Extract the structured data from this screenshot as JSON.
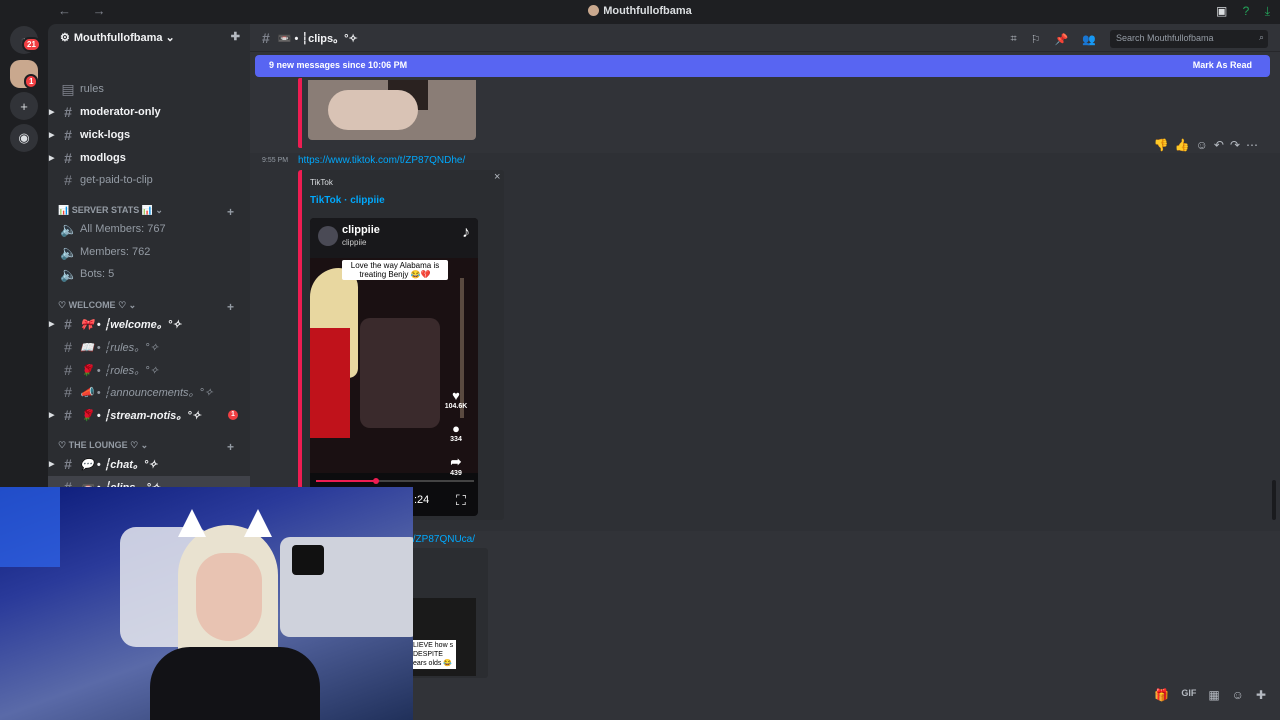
{
  "window": {
    "title": "Mouthfullofbama",
    "back_glyph": "←",
    "forward_glyph": "→",
    "inbox_glyph": "▣",
    "help_glyph": "?",
    "download_glyph": "⤓"
  },
  "guilds": {
    "dm_badge": "21",
    "server_badge": "1",
    "add_glyph": "+",
    "discover_glyph": "◉",
    "dm_glyph": "◔"
  },
  "server": {
    "name": "Mouthfullofbama ⌄",
    "invite_glyph": "✚"
  },
  "channels": [
    {
      "name": "rules",
      "style": "muted",
      "icon": "▤"
    },
    {
      "name": "moderator-only",
      "style": "bold",
      "icon": "#"
    },
    {
      "name": "wick-logs",
      "style": "bold",
      "icon": "#"
    },
    {
      "name": "modlogs",
      "style": "bold",
      "icon": "#"
    },
    {
      "name": "get-paid-to-clip",
      "style": "muted",
      "icon": "#"
    }
  ],
  "categories": {
    "server_stats": "📊 SERVER STATS 📊 ⌄",
    "welcome": "♡ WELCOME ♡ ⌄",
    "lounge": "♡ THE LOUNGE ♡ ⌄",
    "plus": "+"
  },
  "stats": [
    {
      "name": "All Members: 767"
    },
    {
      "name": "Members: 762"
    },
    {
      "name": "Bots: 5"
    }
  ],
  "welcome_channels": [
    {
      "name": "🎀 • ┆welcome。°✧",
      "style": "bold"
    },
    {
      "name": "📖 • ┆rules。°✧",
      "style": "muted"
    },
    {
      "name": "🌹 • ┆roles。°✧",
      "style": "muted"
    },
    {
      "name": "📣 • ┆announcements。°✧",
      "style": "muted"
    },
    {
      "name": "🌹 • ┆stream-notis。°✧",
      "style": "bold",
      "badge": "1"
    }
  ],
  "lounge_channels": [
    {
      "name": "💬 • ┆chat。°✧",
      "style": "bold"
    },
    {
      "name": "📼 • ┆clips。°✧",
      "style": "bold"
    }
  ],
  "header": {
    "channel": "📼 • ┆clips。°✧",
    "search_placeholder": "Search Mouthfullofbama",
    "search_glyph": "⌕",
    "tool_glyphs": [
      "⌗",
      "⚐",
      "📌",
      "👥"
    ]
  },
  "banner": {
    "text": "9 new messages since 10:06 PM",
    "mark_read": "Mark As Read"
  },
  "message": {
    "timestamp": "9:55 PM",
    "link": "https://www.tiktok.com/t/ZP87QNDhe/",
    "embed_provider": "TikTok",
    "embed_title": "TikTok · clippiie",
    "close_glyph": "×",
    "reactions": [
      "👎",
      "👍",
      "☺",
      "↶",
      "↷",
      "⋯"
    ],
    "video": {
      "user_name": "clippiie",
      "user_handle": "clippiie",
      "tiktok_glyph": "♪",
      "caption": "Love the way Alabama is treating Benjy 😂💔",
      "likes": "104.6K",
      "comments": "334",
      "shares": "439",
      "like_glyph": "♥",
      "comment_glyph": "●",
      "share_glyph": "➦",
      "time": ":24",
      "fullscreen_glyph": "⛶",
      "progress": 0.38
    }
  },
  "message2": {
    "link": "t/ZP87QNUca/",
    "caption": "LIEVE how s DESPITE ears olds 😂"
  },
  "composer": {
    "icons": [
      "🎁",
      "GIF",
      "▦",
      "☺",
      "✚"
    ]
  }
}
